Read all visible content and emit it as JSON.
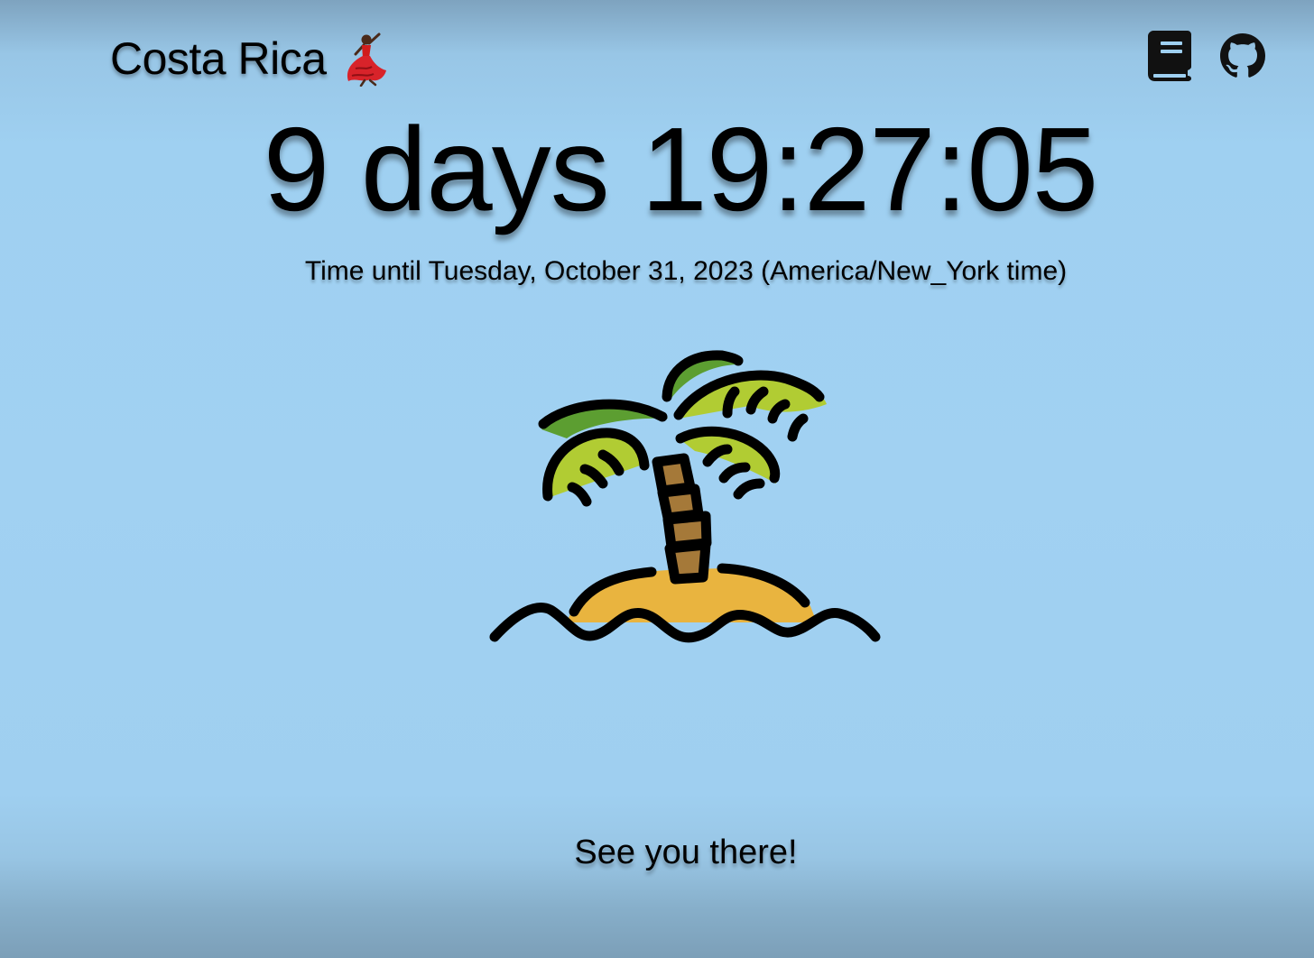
{
  "header": {
    "title": "Costa Rica",
    "title_emoji_icon": "dancer-icon",
    "icons": [
      {
        "name": "book-icon"
      },
      {
        "name": "github-icon"
      }
    ]
  },
  "countdown": {
    "value": "9 days 19:27:05"
  },
  "subtitle": {
    "text": "Time until Tuesday, October 31, 2023 (America/New_York time)"
  },
  "illustration": {
    "icon": "desert-island-icon"
  },
  "footer": {
    "message": "See you there!"
  },
  "colors": {
    "background": "#a1d1f2",
    "text": "#000000",
    "leaf_light": "#b1cc33",
    "leaf_dark": "#5c9e31",
    "trunk": "#a57939",
    "sand": "#e9b43f"
  }
}
